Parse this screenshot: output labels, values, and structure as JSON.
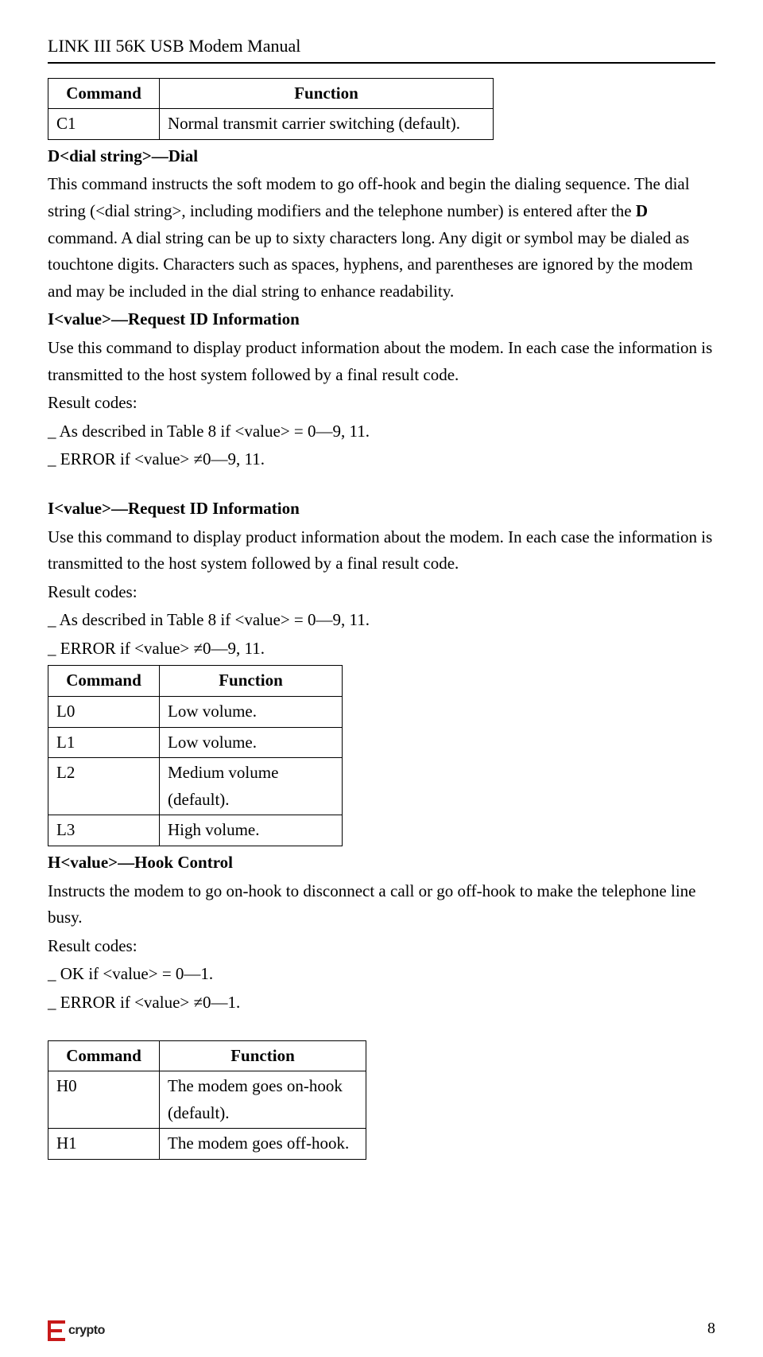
{
  "header": {
    "title": "LINK III 56K USB Modem Manual"
  },
  "table1": {
    "head_cmd": "Command",
    "head_func": "Function",
    "rows": [
      {
        "cmd": "C1",
        "func": "Normal transmit carrier switching (default)."
      }
    ]
  },
  "dial": {
    "heading": "D<dial string>—Dial",
    "para1": "This command instructs the soft modem to go off-hook and begin the dialing sequence. The dial string (<dial string>, including modifiers and the telephone number) is entered after the ",
    "bold_d": "D",
    "para1b": " command. A dial string can be up to sixty characters long. Any digit or symbol may be dialed as touchtone digits. Characters such as spaces, hyphens, and parentheses are ignored by the modem and may be included in the dial string to enhance readability."
  },
  "req1": {
    "heading": "I<value>—Request ID Information",
    "para": "Use this command to display product information about the modem. In each case the information is transmitted to the host system followed by a final result code.",
    "rc_label": "Result codes:",
    "rc1": "_ As described in Table 8 if <value> = 0—9, 11.",
    "rc2": "_ ERROR if <value> ≠0—9, 11."
  },
  "req2": {
    "heading": "I<value>—Request ID Information",
    "para": "Use this command to display product information about the modem. In each case the information is transmitted to the host system followed by a final result code.",
    "rc_label": "Result codes:",
    "rc1": "_ As described in Table 8 if <value> = 0—9, 11.",
    "rc2": "_ ERROR if <value> ≠0—9, 11."
  },
  "table2": {
    "head_cmd": "Command",
    "head_func": "Function",
    "rows": [
      {
        "cmd": "L0",
        "func": "Low volume."
      },
      {
        "cmd": "L1",
        "func": "Low volume."
      },
      {
        "cmd": "L2",
        "func": "Medium volume (default)."
      },
      {
        "cmd": "L3",
        "func": "High volume."
      }
    ]
  },
  "hook": {
    "heading": "H<value>—Hook Control",
    "para": "Instructs the modem to go on-hook to disconnect a call or go off-hook to make the telephone line busy.",
    "rc_label": "Result codes:",
    "rc1": "_ OK if <value> = 0—1.",
    "rc2": "_ ERROR if <value> ≠0—1."
  },
  "table3": {
    "head_cmd": "Command",
    "head_func": "Function",
    "rows": [
      {
        "cmd": "H0",
        "func": "The modem goes on-hook (default)."
      },
      {
        "cmd": "H1",
        "func": "The modem goes off-hook."
      }
    ]
  },
  "footer": {
    "logo_text": "crypto",
    "page": "8"
  }
}
